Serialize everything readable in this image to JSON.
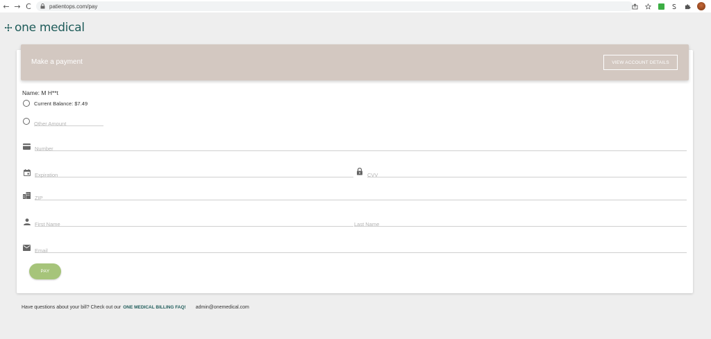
{
  "browser": {
    "url": "patientops.com/pay",
    "back_glyph": "←",
    "forward_glyph": "→",
    "reload_glyph": "C"
  },
  "logo": {
    "text": "one medical"
  },
  "banner": {
    "title": "Make a payment",
    "account_button": "VIEW ACCOUNT DETAILS"
  },
  "patient": {
    "name_line": "Name: M H**t"
  },
  "payment_options": {
    "current_balance_label": "Current Balance: $7.49",
    "other_amount_placeholder": "Other Amount"
  },
  "card_form": {
    "number_placeholder": "Number",
    "expiration_placeholder": "Expiration",
    "cvv_placeholder": "CVV",
    "zip_placeholder": "ZIP",
    "first_name_placeholder": "First Name",
    "last_name_placeholder": "Last Name",
    "email_placeholder": "Email"
  },
  "actions": {
    "pay_label": "PAY"
  },
  "footer": {
    "question_text": "Have questions about your bill? Check out our",
    "faq_link": "ONE MEDICAL BILLING FAQ!",
    "contact_email": "admin@onemedical.com"
  },
  "colors": {
    "brand": "#1f5c5a",
    "banner": "#d3c8c1",
    "pay_button": "#a6c47a",
    "background": "#eeeeee"
  },
  "icons": [
    "back-icon",
    "forward-icon",
    "reload-icon",
    "lock-icon",
    "share-icon",
    "star-icon",
    "extension-green-icon",
    "s-extension-icon",
    "puzzle-icon",
    "profile-avatar",
    "credit-card-icon",
    "calendar-icon",
    "lock-icon",
    "building-icon",
    "person-icon",
    "mail-icon"
  ]
}
